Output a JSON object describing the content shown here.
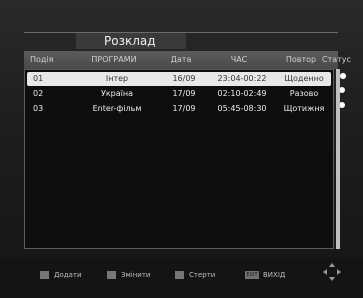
{
  "panel": {
    "title": "Розклад"
  },
  "columns": {
    "id": "Подія",
    "program": "ПРОГРАМИ",
    "date": "Дата",
    "time": "ЧАС",
    "repeat": "Повтор",
    "status": "Статус"
  },
  "rows": [
    {
      "id": "01",
      "program": "Інтер",
      "date": "16/09",
      "time": "23:04-00:22",
      "repeat": "Щоденно",
      "selected": true
    },
    {
      "id": "02",
      "program": "Україна",
      "date": "17/09",
      "time": "02:10-02:49",
      "repeat": "Разово",
      "selected": false
    },
    {
      "id": "03",
      "program": "Enter-фільм",
      "date": "17/09",
      "time": "05:45-08:30",
      "repeat": "Щотижня",
      "selected": false
    }
  ],
  "footer": {
    "add": "Додати",
    "edit": "Змінити",
    "delete": "Стерти",
    "exit_key": "EXIT",
    "exit": "ВИХІД"
  },
  "colors": {
    "selected_row": "#e8e8e8",
    "list_bg": "#0e0e0e",
    "header_bg": "#4a4a4a"
  }
}
